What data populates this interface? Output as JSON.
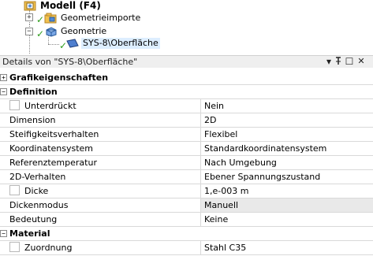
{
  "tree": {
    "items": [
      {
        "label": "Modell (F4)"
      },
      {
        "label": "Geometrieimporte",
        "expander": "+"
      },
      {
        "label": "Geometrie",
        "expander": "−"
      },
      {
        "label": "SYS-8\\Oberfläche"
      }
    ]
  },
  "panel": {
    "title": "Details von \"SYS-8\\Oberfläche\"",
    "buttons": {
      "dropdown": "▾",
      "pin": "ᚁ",
      "maximize": "☐",
      "close": "✕"
    }
  },
  "grid": {
    "categories": {
      "grafik": {
        "label": "Grafikeigenschaften",
        "expander": "+"
      },
      "definition": {
        "label": "Definition",
        "expander": "−"
      },
      "material": {
        "label": "Material",
        "expander": "−"
      }
    },
    "rows": [
      {
        "name": "Unterdrückt",
        "value": "Nein"
      },
      {
        "name": "Dimension",
        "value": "2D"
      },
      {
        "name": "Steifigkeitsverhalten",
        "value": "Flexibel"
      },
      {
        "name": "Koordinatensystem",
        "value": "Standardkoordinatensystem"
      },
      {
        "name": "Referenztemperatur",
        "value": "Nach Umgebung"
      },
      {
        "name": "2D-Verhalten",
        "value": "Ebener Spannungszustand"
      },
      {
        "name": "Dicke",
        "value": "1,e-003 m"
      },
      {
        "name": "Dickenmodus",
        "value": "Manuell"
      },
      {
        "name": "Bedeutung",
        "value": "Keine"
      }
    ],
    "material_rows": [
      {
        "name": "Zuordnung",
        "value": "Stahl C35"
      }
    ]
  },
  "colors": {
    "check": "#2e9d1b",
    "folder": "#f2c14e",
    "selection": "#ddeeff"
  }
}
